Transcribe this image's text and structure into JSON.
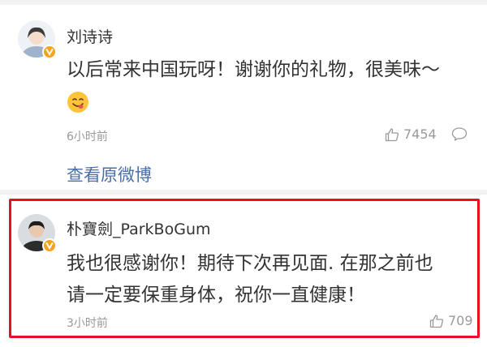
{
  "comment1": {
    "name": "刘诗诗",
    "text_line1": "以后常来中国玩呀！谢谢你的礼物，很美味～",
    "emoji": "smiling-face-savoring-icon",
    "time": "6小时前",
    "likes": "7454",
    "view_original": "查看原微博"
  },
  "comment2": {
    "name": "朴寶劍_ParkBoGum",
    "text_line1": "我也很感谢你！期待下次再见面. 在那之前也",
    "text_line2": "请一定要保重身体，祝你一直健康！",
    "time": "3小时前",
    "likes": "709"
  },
  "colors": {
    "highlight_border": "#e8101e",
    "verified_badge": "#f7a21b",
    "link": "#4a6fa5"
  }
}
